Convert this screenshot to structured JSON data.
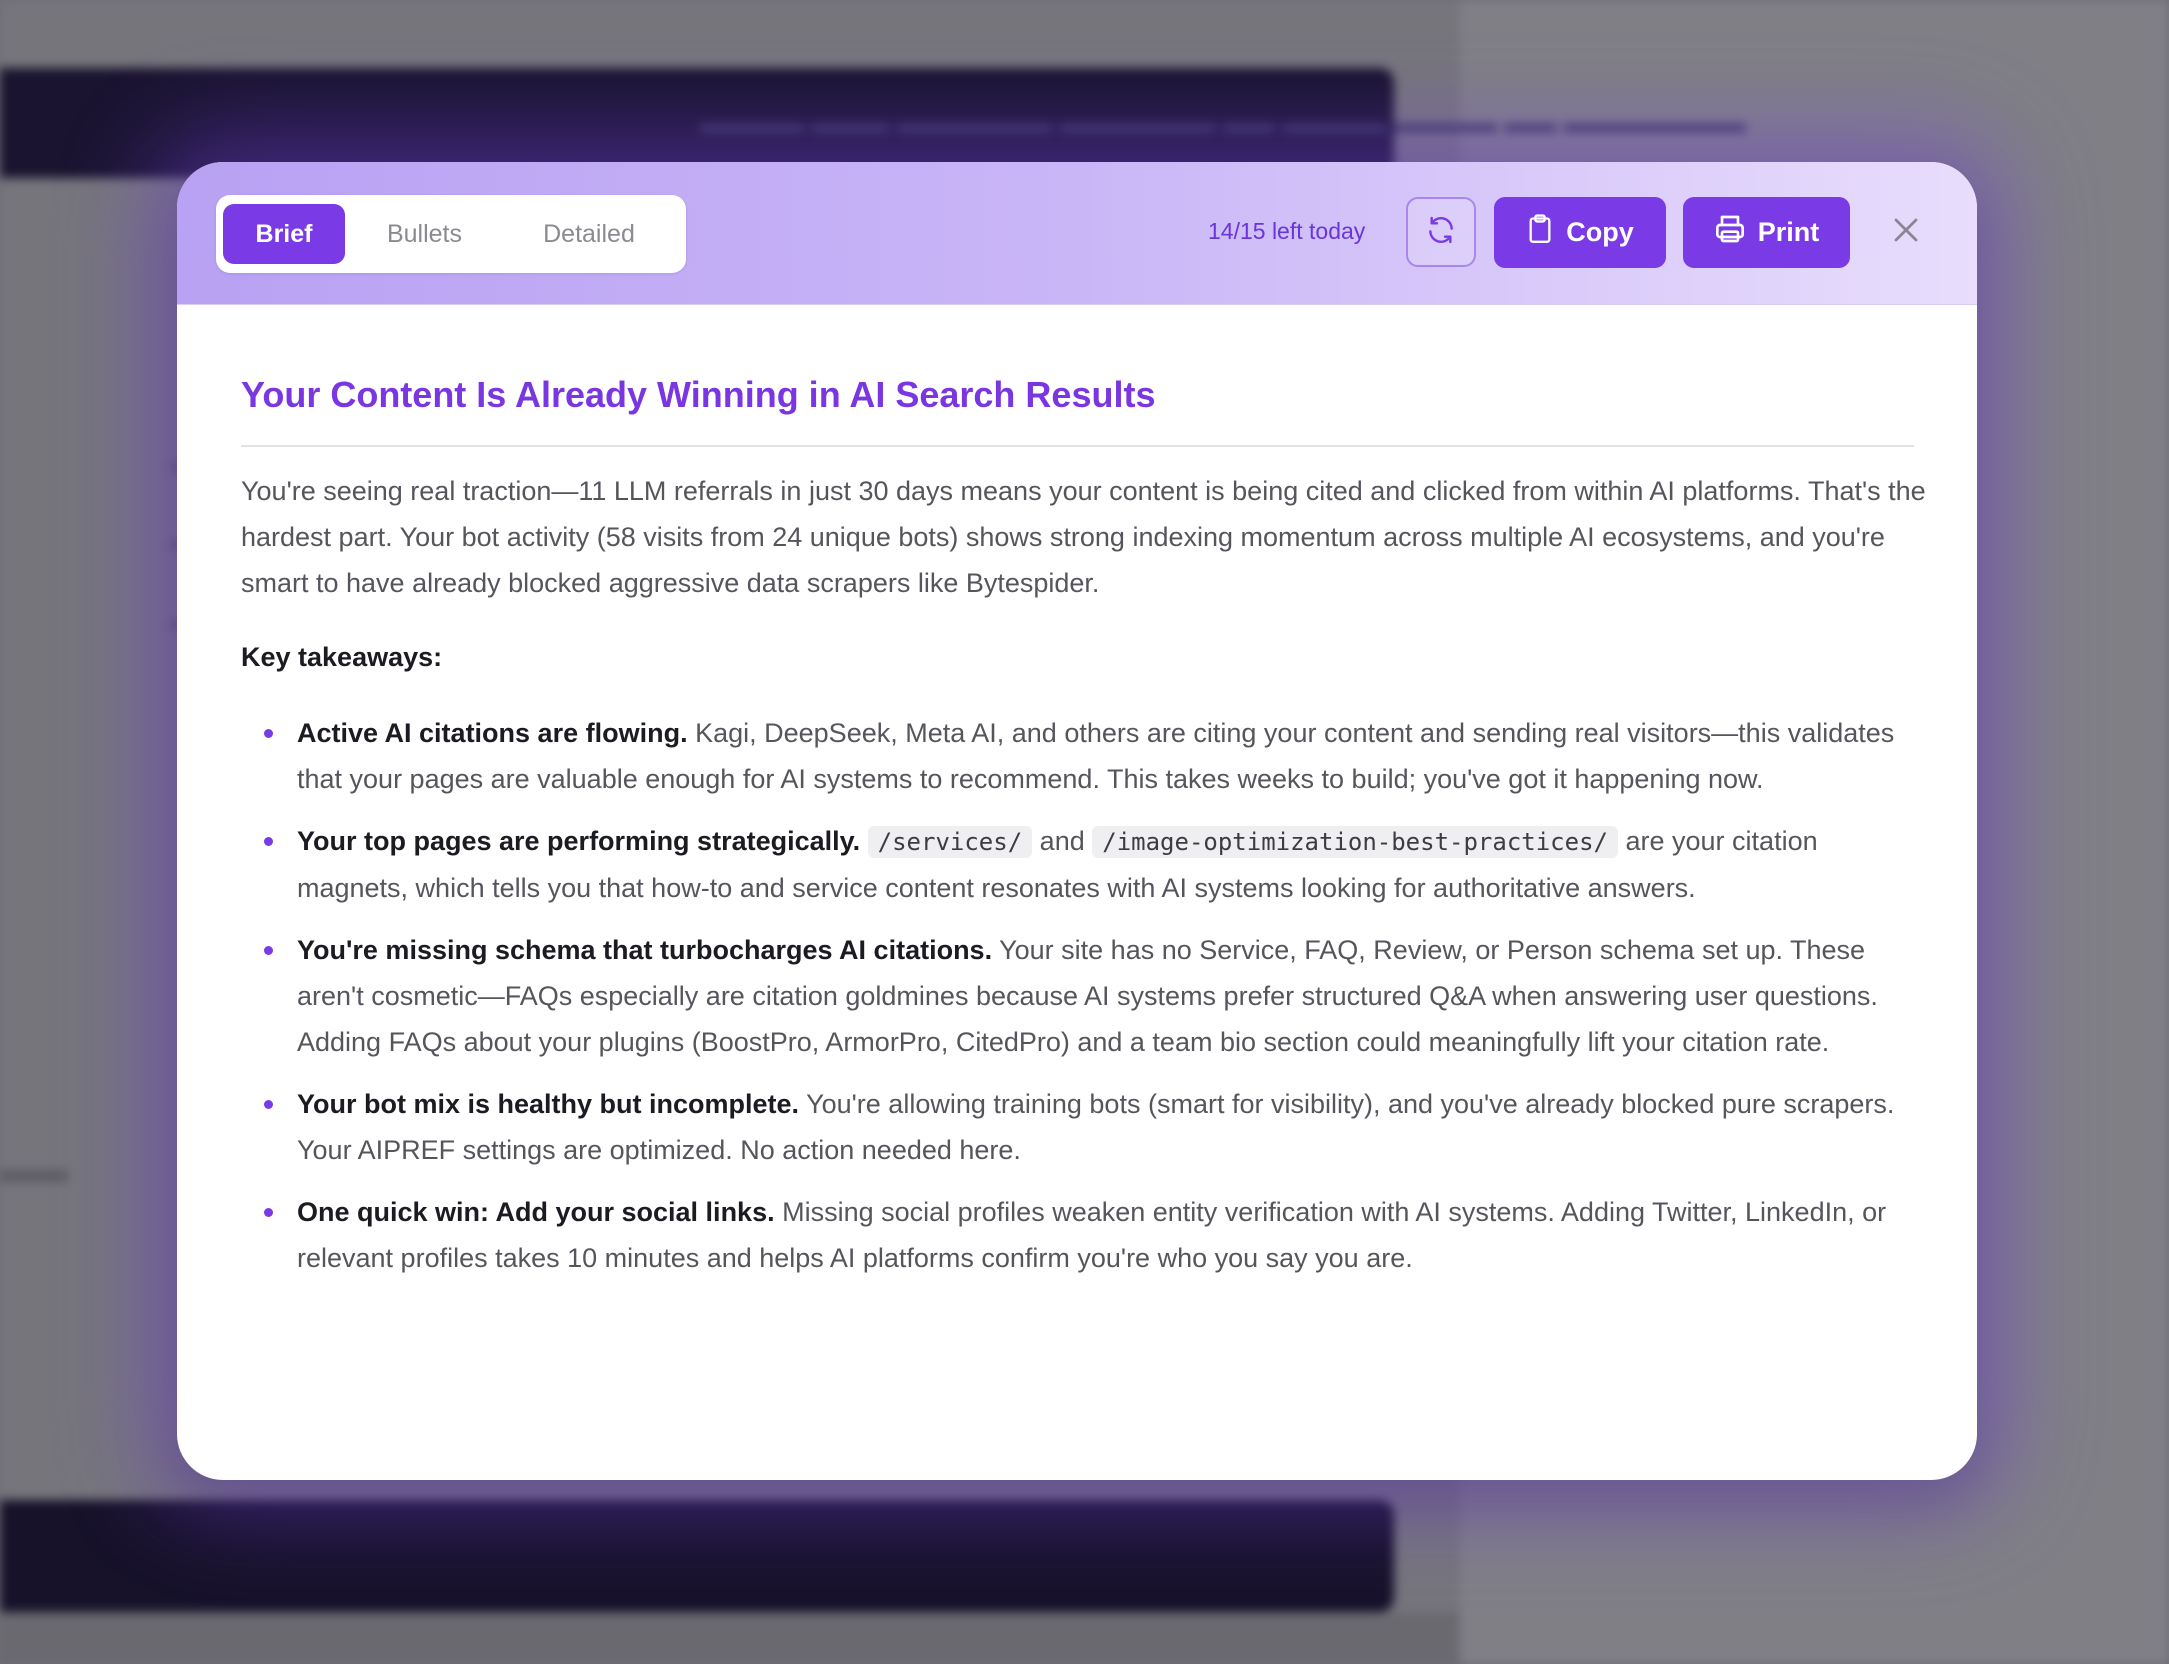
{
  "tabs": [
    {
      "label": "Brief",
      "active": true
    },
    {
      "label": "Bullets",
      "active": false
    },
    {
      "label": "Detailed",
      "active": false
    }
  ],
  "header": {
    "usage": "14/15 left today",
    "copy_label": "Copy",
    "print_label": "Print",
    "refresh_icon": "refresh-icon",
    "close_icon": "close-icon"
  },
  "colors": {
    "accent": "#7a3ae6",
    "title": "#7a36e0",
    "header_gradient_start": "#b9a1f3",
    "header_gradient_end": "#e8ddfc"
  },
  "report": {
    "title": "Your Content Is Already Winning in AI Search Results",
    "intro": "You're seeing real traction—11 LLM referrals in just 30 days means your content is being cited and clicked from within AI platforms. That's the hardest part. Your bot activity (58 visits from 24 unique bots) shows strong indexing momentum across multiple AI ecosystems, and you're smart to have already blocked aggressive data scrapers like Bytespider.",
    "takeaways_heading": "Key takeaways:",
    "takeaways": [
      {
        "lead": "Active AI citations are flowing.",
        "text": "Kagi, DeepSeek, Meta AI, and others are citing your content and sending real visitors—this validates that your pages are valuable enough for AI systems to recommend. This takes weeks to build; you've got it happening now."
      },
      {
        "lead": "Your top pages are performing strategically.",
        "code1": "/services/",
        "joiner": "and",
        "code2": "/image-optimization-best-practices/",
        "text": "are your citation magnets, which tells you that how-to and service content resonates with AI systems looking for authoritative answers."
      },
      {
        "lead": "You're missing schema that turbocharges AI citations.",
        "text": "Your site has no Service, FAQ, Review, or Person schema set up. These aren't cosmetic—FAQs especially are citation goldmines because AI systems prefer structured Q&A when answering user questions. Adding FAQs about your plugins (BoostPro, ArmorPro, CitedPro) and a team bio section could meaningfully lift your citation rate."
      },
      {
        "lead": "Your bot mix is healthy but incomplete.",
        "text": "You're allowing training bots (smart for visibility), and you've already blocked pure scrapers. Your AIPREF settings are optimized. No action needed here."
      },
      {
        "lead": "One quick win: Add your social links.",
        "text": "Missing social profiles weaken entity verification with AI systems. Adding Twitter, LinkedIn, or relevant profiles takes 10 minutes and helps AI platforms confirm you're who you say you are."
      }
    ]
  }
}
